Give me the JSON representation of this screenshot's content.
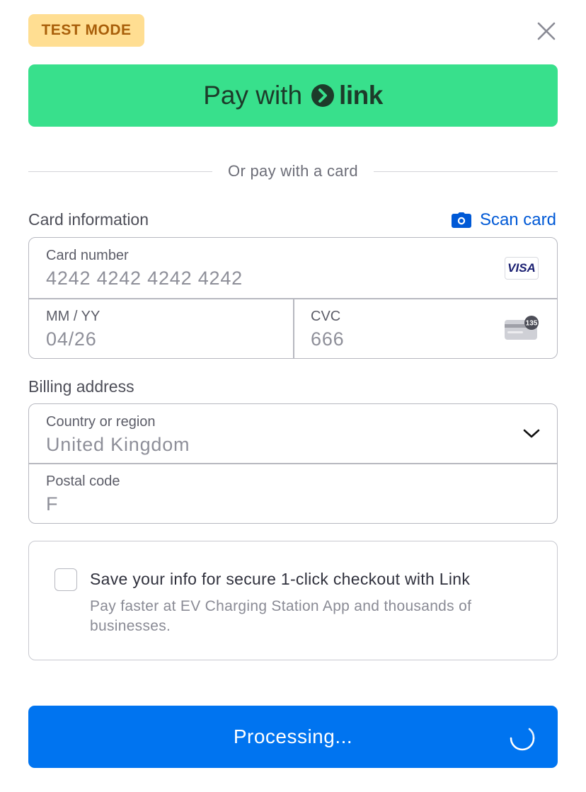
{
  "header": {
    "test_mode_label": "TEST MODE",
    "close_icon": "close-icon"
  },
  "link_button": {
    "prefix": "Pay with",
    "brand": "link",
    "icon": "link-chevron-icon",
    "color": "#38e08c"
  },
  "divider_text": "Or pay with a card",
  "card_info": {
    "label": "Card information",
    "scan_label": "Scan card",
    "scan_icon": "camera-icon",
    "card_number_label": "Card number",
    "card_number_value": "4242 4242 4242 4242",
    "brand_badge": "VISA",
    "expiry_label": "MM / YY",
    "expiry_value": "04/26",
    "cvc_label": "CVC",
    "cvc_value": "666",
    "cvc_icon_text": "135",
    "cvc_icon": "card-back-cvc-icon"
  },
  "billing": {
    "label": "Billing address",
    "country_label": "Country or region",
    "country_value": "United Kingdom",
    "country_icon": "chevron-down-icon",
    "postal_label": "Postal code",
    "postal_value": "F"
  },
  "save_info": {
    "title": "Save your info for secure 1-click checkout with Link",
    "description": "Pay faster at EV Charging Station App and thousands of businesses.",
    "checked": false
  },
  "submit": {
    "label": "Processing...",
    "color": "#0074f0",
    "icon": "spinner-icon"
  }
}
